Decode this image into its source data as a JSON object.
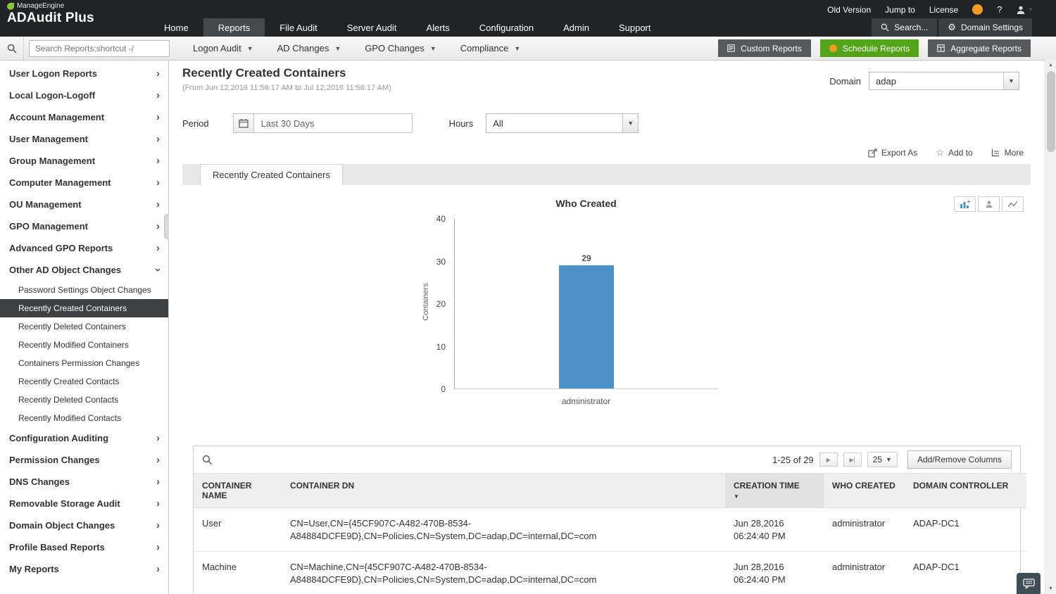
{
  "colors": {
    "topbar_bg": "#222325",
    "accent_green": "#53a318",
    "dark_button": "#58595b",
    "bar_blue": "#4d92c6",
    "selected_sidebar_bg": "#3f4041",
    "orange_icon": "#f59a23"
  },
  "header": {
    "brand_top": "ManageEngine",
    "brand_main": "ADAudit Plus",
    "utility": [
      "Old Version",
      "Jump to",
      "License"
    ],
    "nav": [
      "Home",
      "Reports",
      "File Audit",
      "Server Audit",
      "Alerts",
      "Configuration",
      "Admin",
      "Support"
    ],
    "active_nav": "Reports",
    "search_label": "Search...",
    "domain_settings_label": "Domain Settings"
  },
  "toolbar": {
    "search_placeholder": "Search Reports;shortcut -/",
    "menus": [
      "Logon Audit",
      "AD Changes",
      "GPO Changes",
      "Compliance"
    ],
    "buttons": {
      "custom": "Custom Reports",
      "schedule": "Schedule Reports",
      "aggregate": "Aggregate Reports"
    }
  },
  "sidebar": {
    "items": [
      "User Logon Reports",
      "Local Logon-Logoff",
      "Account Management",
      "User Management",
      "Group Management",
      "Computer Management",
      "OU Management",
      "GPO Management",
      "Advanced GPO Reports",
      "Other AD Object Changes",
      "Configuration Auditing",
      "Permission Changes",
      "DNS Changes",
      "Removable Storage Audit",
      "Domain Object Changes",
      "Profile Based Reports",
      "My Reports"
    ],
    "expanded_item": "Other AD Object Changes",
    "sub_items": [
      "Password Settings Object Changes",
      "Recently Created Containers",
      "Recently Deleted Containers",
      "Recently Modified Containers",
      "Containers Permission Changes",
      "Recently Created Contacts",
      "Recently Deleted Contacts",
      "Recently Modified Contacts"
    ],
    "selected_sub_item": "Recently Created Containers"
  },
  "page": {
    "title": "Recently Created Containers",
    "date_range": "(From Jun 12,2016 11:56:17 AM to Jul 12,2016 11:56:17 AM)",
    "domain_label": "Domain",
    "domain_value": "adap",
    "period_label": "Period",
    "period_value": "Last 30 Days",
    "hours_label": "Hours",
    "hours_value": "All",
    "export_label": "Export As",
    "addto_label": "Add to",
    "more_label": "More",
    "tab_label": "Recently Created Containers"
  },
  "chart_data": {
    "type": "bar",
    "title": "Who Created",
    "categories": [
      "administrator"
    ],
    "values": [
      29
    ],
    "xlabel": "",
    "ylabel": "Containers",
    "ylim": [
      0,
      40
    ],
    "yticks": [
      0,
      10,
      20,
      30,
      40
    ],
    "bar_color": "#4d92c6",
    "grid": false,
    "legend": "none"
  },
  "table": {
    "pagination_text": "1-25 of 29",
    "page_size": "25",
    "add_remove_columns_label": "Add/Remove Columns",
    "headers": [
      "CONTAINER NAME",
      "CONTAINER DN",
      "CREATION TIME",
      "WHO CREATED",
      "DOMAIN CONTROLLER"
    ],
    "sorted_by": "CREATION TIME",
    "sort_direction": "desc",
    "rows": [
      {
        "name": "User",
        "dn": "CN=User,CN={45CF907C-A482-470B-8534-A84884DCFE9D},CN=Policies,CN=System,DC=adap,DC=internal,DC=com",
        "created": "Jun 28,2016 06:24:40 PM",
        "who": "administrator",
        "dc": "ADAP-DC1"
      },
      {
        "name": "Machine",
        "dn": "CN=Machine,CN={45CF907C-A482-470B-8534-A84884DCFE9D},CN=Policies,CN=System,DC=adap,DC=internal,DC=com",
        "created": "Jun 28,2016 06:24:40 PM",
        "who": "administrator",
        "dc": "ADAP-DC1"
      }
    ]
  }
}
